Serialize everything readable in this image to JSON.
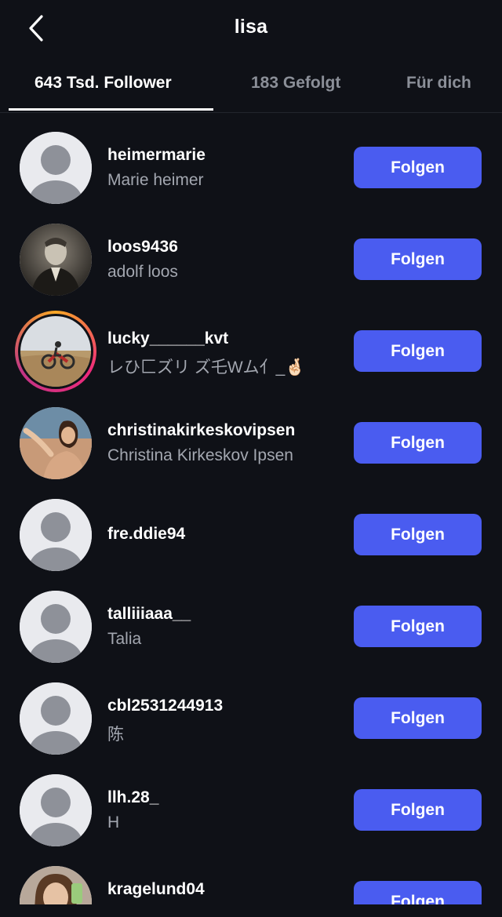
{
  "header": {
    "title": "lisa"
  },
  "tabs": [
    {
      "label": "643 Tsd. Follower",
      "active": true
    },
    {
      "label": "183 Gefolgt",
      "active": false
    },
    {
      "label": "Für dich",
      "active": false
    }
  ],
  "follow_label": "Folgen",
  "users": [
    {
      "username": "heimermarie",
      "fullname": "Marie heimer",
      "avatar": "default-avatar"
    },
    {
      "username": "loos9436",
      "fullname": "adolf loos",
      "avatar": "photo"
    },
    {
      "username": "lucky______kvt",
      "fullname": "レひ匚ズリ ズ乇Wム亻_🤞🏻",
      "avatar": "photo-story-ring"
    },
    {
      "username": "christinakirkeskovipsen",
      "fullname": "Christina Kirkeskov Ipsen",
      "avatar": "photo"
    },
    {
      "username": "fre.ddie94",
      "fullname": "",
      "avatar": "default-avatar"
    },
    {
      "username": "talliiiaaa__",
      "fullname": "Talia",
      "avatar": "default-avatar"
    },
    {
      "username": "cbl2531244913",
      "fullname": "陈",
      "avatar": "default-avatar"
    },
    {
      "username": "llh.28_",
      "fullname": "H",
      "avatar": "default-avatar"
    },
    {
      "username": "kragelund04",
      "fullname": "",
      "avatar": "photo"
    }
  ],
  "colors": {
    "background": "#0f1117",
    "accent": "#4a5cf0",
    "secondary_text": "#a3a7b0"
  }
}
